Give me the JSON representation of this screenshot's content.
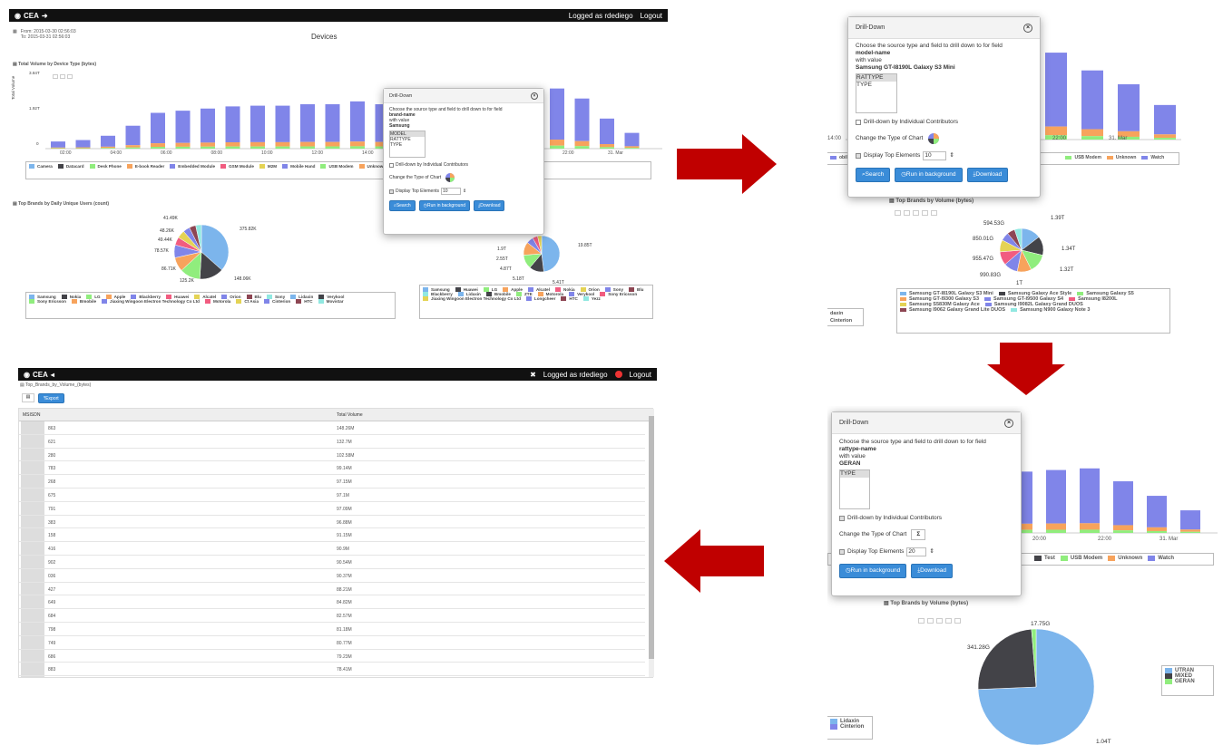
{
  "panel1": {
    "topbar": {
      "brand": "CEA",
      "logged": "Logged as rdediego",
      "logout": "Logout"
    },
    "from": "From: 2015-03-30 02:56:03",
    "to": "To: 2015-03-31 02:56:03",
    "title": "Devices",
    "chart1_title": "Total Volume by Device Type (bytes)",
    "y_label": "Total Volume",
    "y_ticks": [
      "3.84T",
      "1.92T",
      "0"
    ],
    "x_ticks": [
      "02:00",
      "04:00",
      "06:00",
      "08:00",
      "10:00",
      "12:00",
      "14:00",
      "22:00",
      "31. Mar"
    ],
    "bars_purple": [
      0.1,
      0.12,
      0.18,
      0.32,
      0.5,
      0.53,
      0.56,
      0.59,
      0.6,
      0.6,
      0.62,
      0.62,
      0.66,
      0.62,
      0.58,
      0.55,
      0.62,
      0.72,
      0.73,
      0.82,
      0.84,
      0.7,
      0.42,
      0.22
    ],
    "legend1": [
      {
        "label": "Camera",
        "color": "#7cb5ec"
      },
      {
        "label": "Datacard",
        "color": "#434348"
      },
      {
        "label": "Desk Phone",
        "color": "#90ed7d"
      },
      {
        "label": "E-book Reader",
        "color": "#f7a35c"
      },
      {
        "label": "Embedded Module",
        "color": "#8085e9"
      },
      {
        "label": "GSM Module",
        "color": "#f15c80"
      },
      {
        "label": "M2M",
        "color": "#e4d354"
      },
      {
        "label": "Mobile Hand",
        "color": "#8085e8"
      },
      {
        "label": "USB Modem",
        "color": "#90ed7d"
      },
      {
        "label": "Unknown",
        "color": "#f7a35c"
      },
      {
        "label": "Watch",
        "color": "#8085e9"
      },
      {
        "label": "Wireless Router",
        "color": "#f15c80"
      }
    ],
    "chart2_title": "Top Brands by Daily Unique Users (count)",
    "pie_labels": [
      "41.49K",
      "48.26K",
      "49.44K",
      "78.57K",
      "86.71K",
      "125.2K",
      "148.06K",
      "375.82K"
    ],
    "legend2": [
      {
        "label": "Samsung",
        "color": "#7cb5ec"
      },
      {
        "label": "Nokia",
        "color": "#434348"
      },
      {
        "label": "LG",
        "color": "#90ed7d"
      },
      {
        "label": "Apple",
        "color": "#f7a35c"
      },
      {
        "label": "Blackberry",
        "color": "#8085e9"
      },
      {
        "label": "Huawei",
        "color": "#f15c80"
      },
      {
        "label": "Alcatel",
        "color": "#e4d354"
      },
      {
        "label": "Orion",
        "color": "#8085e8"
      },
      {
        "label": "Blu",
        "color": "#8d4653"
      },
      {
        "label": "Sony",
        "color": "#91e8e1"
      },
      {
        "label": "Lidaxin",
        "color": "#7cb5ec"
      },
      {
        "label": "Verykool",
        "color": "#434348"
      },
      {
        "label": "Sony Ericsson",
        "color": "#90ed7d"
      },
      {
        "label": "Bmobile",
        "color": "#f7a35c"
      },
      {
        "label": "Jiaxing Wingoon Electron Technology Co Ltd",
        "color": "#8085e9"
      },
      {
        "label": "Motorola",
        "color": "#f15c80"
      },
      {
        "label": "Ct Asia",
        "color": "#e4d354"
      },
      {
        "label": "Cinterion",
        "color": "#8085e8"
      },
      {
        "label": "HTC",
        "color": "#8d4653"
      },
      {
        "label": "Movistar",
        "color": "#91e8e1"
      }
    ],
    "pie2_labels": [
      "19.85T",
      "1.9T",
      "2.55T",
      "4.87T",
      "5.18T",
      "5.41T"
    ],
    "legend3": [
      {
        "label": "Samsung",
        "color": "#7cb5ec"
      },
      {
        "label": "Huawei",
        "color": "#434348"
      },
      {
        "label": "LG",
        "color": "#90ed7d"
      },
      {
        "label": "Apple",
        "color": "#f7a35c"
      },
      {
        "label": "Alcatel",
        "color": "#8085e9"
      },
      {
        "label": "Nokia",
        "color": "#f15c80"
      },
      {
        "label": "Orion",
        "color": "#e4d354"
      },
      {
        "label": "Sony",
        "color": "#8085e8"
      },
      {
        "label": "Blu",
        "color": "#8d4653"
      },
      {
        "label": "Blackberry",
        "color": "#91e8e1"
      },
      {
        "label": "Lidaxin",
        "color": "#7cb5ec"
      },
      {
        "label": "Bmobile",
        "color": "#434348"
      },
      {
        "label": "ZTE",
        "color": "#90ed7d"
      },
      {
        "label": "Motorola",
        "color": "#f7a35c"
      },
      {
        "label": "Verykool",
        "color": "#8085e9"
      },
      {
        "label": "Sony Ericsson",
        "color": "#f15c80"
      },
      {
        "label": "Jiaxing Wingoon Electron Technology Co Ltd",
        "color": "#e4d354"
      },
      {
        "label": "Longcheer",
        "color": "#8085e8"
      },
      {
        "label": "HTC",
        "color": "#8d4653"
      },
      {
        "label": "Yezz",
        "color": "#91e8e1"
      }
    ],
    "dialog": {
      "title": "Drill-Down",
      "desc": "Choose the source type and field to drill down to for field",
      "field": "brand-name",
      "with_value": "with value",
      "value": "Samsung",
      "options": [
        "MODEL",
        "RATTYPE",
        "TYPE"
      ],
      "contrib": "Drill-down by Individual Contributors",
      "chart_type": "Change the Type of Chart",
      "top": "Display Top Elements",
      "top_value": "10",
      "search": "Search",
      "background": "Run in background",
      "download": "Download"
    }
  },
  "panel2": {
    "dialog": {
      "title": "Drill-Down",
      "desc": "Choose the source type and field to drill down to for field",
      "field": "model-name",
      "with_value": "with value",
      "value": "Samsung GT-I8190L Galaxy S3 Mini",
      "options": [
        "RATTYPE",
        "TYPE"
      ],
      "contrib": "Drill-down by Individual Contributors",
      "chart_type": "Change the Type of Chart",
      "top": "Display Top Elements",
      "top_value": "10",
      "search": "Search",
      "background": "Run in background",
      "download": "Download"
    },
    "x_ticks": [
      "14:00",
      "22:00",
      "31. Mar"
    ],
    "legend_partial": [
      {
        "label": "obile Ha",
        "color": "#8085e9"
      },
      {
        "label": "USB Modem",
        "color": "#90ed7d"
      },
      {
        "label": "Unknown",
        "color": "#f7a35c"
      },
      {
        "label": "Watch",
        "color": "#8085e9"
      }
    ],
    "chart_title": "Top Brands by Volume (bytes)",
    "pie_labels": [
      "594.53G",
      "850.01G",
      "955.47G",
      "990.83G",
      "1T",
      "1.32T",
      "1.34T",
      "1.39T"
    ],
    "legend": [
      {
        "label": "Samsung GT-I8190L Galaxy S3 Mini",
        "color": "#7cb5ec"
      },
      {
        "label": "Samsung Galaxy Ace Style",
        "color": "#434348"
      },
      {
        "label": "Samsung Galaxy S5",
        "color": "#90ed7d"
      },
      {
        "label": "Samsung GT-I9300 Galaxy S3",
        "color": "#f7a35c"
      },
      {
        "label": "Samsung GT-I9500 Galaxy S4",
        "color": "#8085e9"
      },
      {
        "label": "Samsung I8200L",
        "color": "#f15c80"
      },
      {
        "label": "Samsung S5830M Galaxy Ace",
        "color": "#e4d354"
      },
      {
        "label": "Samsung I9082L Galaxy Grand DUOS",
        "color": "#8085e8"
      },
      {
        "label": "Samsung I9062 Galaxy Grand Lite DUOS",
        "color": "#8d4653"
      },
      {
        "label": "Samsung N900 Galaxy Note 3",
        "color": "#91e8e1"
      }
    ],
    "left_legend": [
      "daxin",
      "Cinterion"
    ]
  },
  "panel3": {
    "topbar": {
      "brand": "CEA",
      "logged": "Logged as rdediego",
      "logout": "Logout"
    },
    "title": "Top_Brands_by_Volume_(bytes)",
    "export": "Export",
    "col1": "MSISDN",
    "col2": "Total Volume",
    "rows": [
      {
        "id": "863",
        "vol": "148.26M"
      },
      {
        "id": "621",
        "vol": "132.7M"
      },
      {
        "id": "280",
        "vol": "102.58M"
      },
      {
        "id": "783",
        "vol": "99.14M"
      },
      {
        "id": "268",
        "vol": "97.15M"
      },
      {
        "id": "675",
        "vol": "97.1M"
      },
      {
        "id": "791",
        "vol": "97.09M"
      },
      {
        "id": "383",
        "vol": "96.88M"
      },
      {
        "id": "158",
        "vol": "91.15M"
      },
      {
        "id": "416",
        "vol": "90.9M"
      },
      {
        "id": "902",
        "vol": "90.54M"
      },
      {
        "id": "036",
        "vol": "90.37M"
      },
      {
        "id": "427",
        "vol": "88.21M"
      },
      {
        "id": "649",
        "vol": "84.82M"
      },
      {
        "id": "684",
        "vol": "82.57M"
      },
      {
        "id": "798",
        "vol": "81.18M"
      },
      {
        "id": "749",
        "vol": "80.77M"
      },
      {
        "id": "686",
        "vol": "79.23M"
      },
      {
        "id": "883",
        "vol": "78.41M"
      }
    ]
  },
  "panel4": {
    "dialog": {
      "title": "Drill-Down",
      "desc": "Choose the source type and field to drill down to for field",
      "field": "rattype-name",
      "with_value": "with value",
      "value": "GERAN",
      "options": [
        "TYPE"
      ],
      "contrib": "Drill-down by Individual Contributors",
      "chart_type": "Change the Type of Chart",
      "top": "Display Top Elements",
      "top_value": "20",
      "background": "Run in background",
      "download": "Download"
    },
    "x_ticks": [
      "20:00",
      "22:00",
      "31. Mar"
    ],
    "legend_partial": [
      {
        "label": "Test",
        "color": "#434348"
      },
      {
        "label": "USB Modem",
        "color": "#90ed7d"
      },
      {
        "label": "Unknown",
        "color": "#f7a35c"
      },
      {
        "label": "Watch",
        "color": "#8085e9"
      }
    ],
    "chart_title": "Top Brands by Volume (bytes)",
    "pie_labels": [
      "17.75G",
      "341.28G",
      "1.04T"
    ],
    "legend": [
      {
        "label": "UTRAN",
        "color": "#7cb5ec"
      },
      {
        "label": "MIXED",
        "color": "#434348"
      },
      {
        "label": "GERAN",
        "color": "#90ed7d"
      }
    ],
    "left_legend": [
      {
        "label": "Lidaxin",
        "color": "#7cb5ec"
      },
      {
        "label": "Cinterion",
        "color": "#8085e9"
      }
    ]
  },
  "colors": {
    "arrow": "#c00000",
    "button": "#3a8cd8",
    "topbar": "#111111",
    "purple": "#8085e9",
    "orange": "#f7a35c",
    "green": "#90ed7d"
  }
}
